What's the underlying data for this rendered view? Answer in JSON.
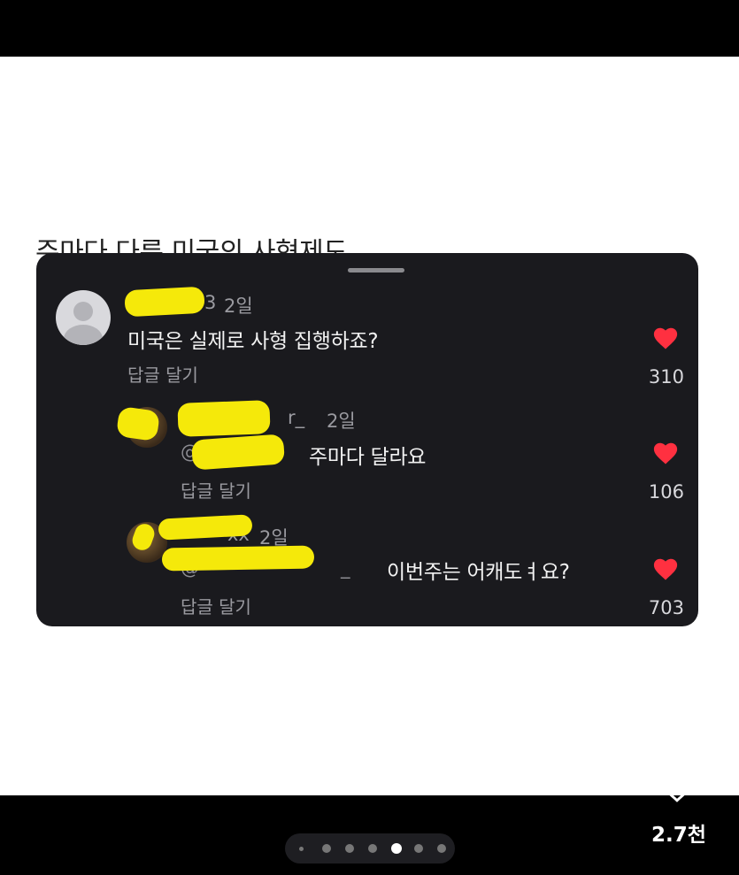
{
  "post": {
    "title": "주마다 다른 미국의 사형제도"
  },
  "comments": [
    {
      "username_suffix": "3",
      "time": "2일",
      "text": "미국은 실제로 사형 집행하죠?",
      "reply_label": "답글 달기",
      "likes": "310"
    },
    {
      "username_suffix": "r_",
      "time": "2일",
      "mention": "@",
      "text": "주마다 달라요",
      "reply_label": "답글 달기",
      "likes": "106"
    },
    {
      "username_suffix": "xx",
      "time": "2일",
      "mention": "@",
      "mention_suffix": "_",
      "text": "이번주는 어캐도ㅕ요?",
      "reply_label": "답글 달기",
      "likes": "703"
    }
  ],
  "actions": {
    "like_total": "2.7천"
  },
  "pagination": {
    "total": 7,
    "active_index": 4
  },
  "colors": {
    "heart": "#ff3040",
    "panel_bg": "#1a1a1e",
    "redaction": "#f5e90a"
  },
  "icons": {
    "like": "heart-outline-icon",
    "comment_like": "heart-filled-icon",
    "avatar_default": "person-silhouette-icon"
  }
}
